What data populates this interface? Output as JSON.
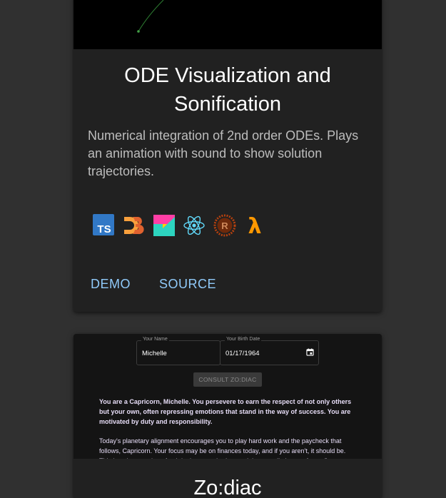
{
  "project1": {
    "title": "ODE Visualization and Sonification",
    "description": "Numerical integration of 2nd order ODEs. Plays an animation with sound to show solution trajectories.",
    "tech_icons": [
      {
        "name": "typescript-icon",
        "text": "TS",
        "color": "#3178c6"
      },
      {
        "name": "d3-icon",
        "color": "#f9a03c"
      },
      {
        "name": "webgl-icon",
        "color": "#ff3ea5"
      },
      {
        "name": "react-icon",
        "color": "#61dafb"
      },
      {
        "name": "rust-icon",
        "text": "R",
        "color": "#b7410e"
      },
      {
        "name": "lambda-icon",
        "text": "λ",
        "color": "#ff9800"
      }
    ],
    "demo_label": "DEMO",
    "source_label": "SOURCE"
  },
  "project2": {
    "preview": {
      "name_label": "Your Name",
      "name_value": "Michelle",
      "date_label": "Your Birth Date",
      "date_value": "01/17/1964",
      "consult_label": "CONSULT ZO:DIAC",
      "horoscope_bold": "You are a Capricorn, Michelle. You persevere to earn the respect of not only others but your own, often repressing emotions that stand in the way of success. You are motivated by duty and responsibility.",
      "horoscope_body": "Today's planetary alignment encourages you to play hard work and the paycheck that follows, Capricorn. Your focus may be on finances today, and if you aren't, it should be. This is a time to take a fresh look at your budget and the overall picture of your finances."
    },
    "title": "Zo:diac"
  },
  "colors": {
    "background": "#303030",
    "card": "#212121",
    "link": "#90caf9"
  }
}
